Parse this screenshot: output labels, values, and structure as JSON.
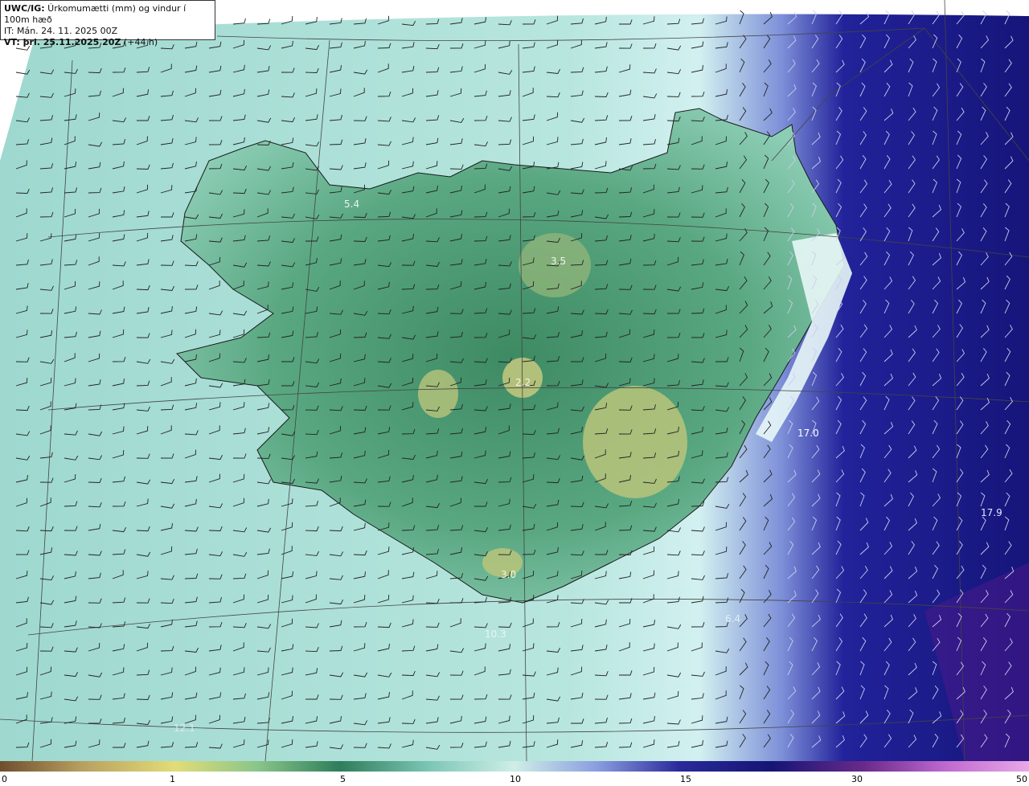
{
  "header": {
    "line1_bold": "UWC/IG:",
    "line1_text": " Úrkomumætti (mm) og vindur í 100m hæð",
    "line2_text": "IT: Mán. 24. 11. 2025 00Z",
    "line3_bold": "VT: þri. 25.11.2025 20Z",
    "line3_text": " (+44 h)"
  },
  "value_labels": [
    {
      "text": "5.4",
      "pos": "north-west highlands"
    },
    {
      "text": "3.5",
      "pos": "north central highlands"
    },
    {
      "text": "2.2",
      "pos": "central highlands"
    },
    {
      "text": "3.0",
      "pos": "south coast glacier"
    },
    {
      "text": "17.0",
      "pos": "east sea"
    },
    {
      "text": "17.9",
      "pos": "far east sea"
    },
    {
      "text": "6.4",
      "pos": "south-east sea"
    },
    {
      "text": "10.3",
      "pos": "south sea"
    },
    {
      "text": "12.1",
      "pos": "south-west sea"
    }
  ],
  "colorbar": {
    "ticks": [
      "0",
      "1",
      "5",
      "10",
      "15",
      "30",
      "50"
    ],
    "colors": [
      "#7a5a3a",
      "#c8b46e",
      "#e6e07a",
      "#8cc38a",
      "#2e7d5b",
      "#cfeee6",
      "#bfe3f0",
      "#8a9ee0",
      "#2a2a9a",
      "#151575",
      "#6a2a8a",
      "#c06ad0",
      "#e8a8e8"
    ]
  }
}
